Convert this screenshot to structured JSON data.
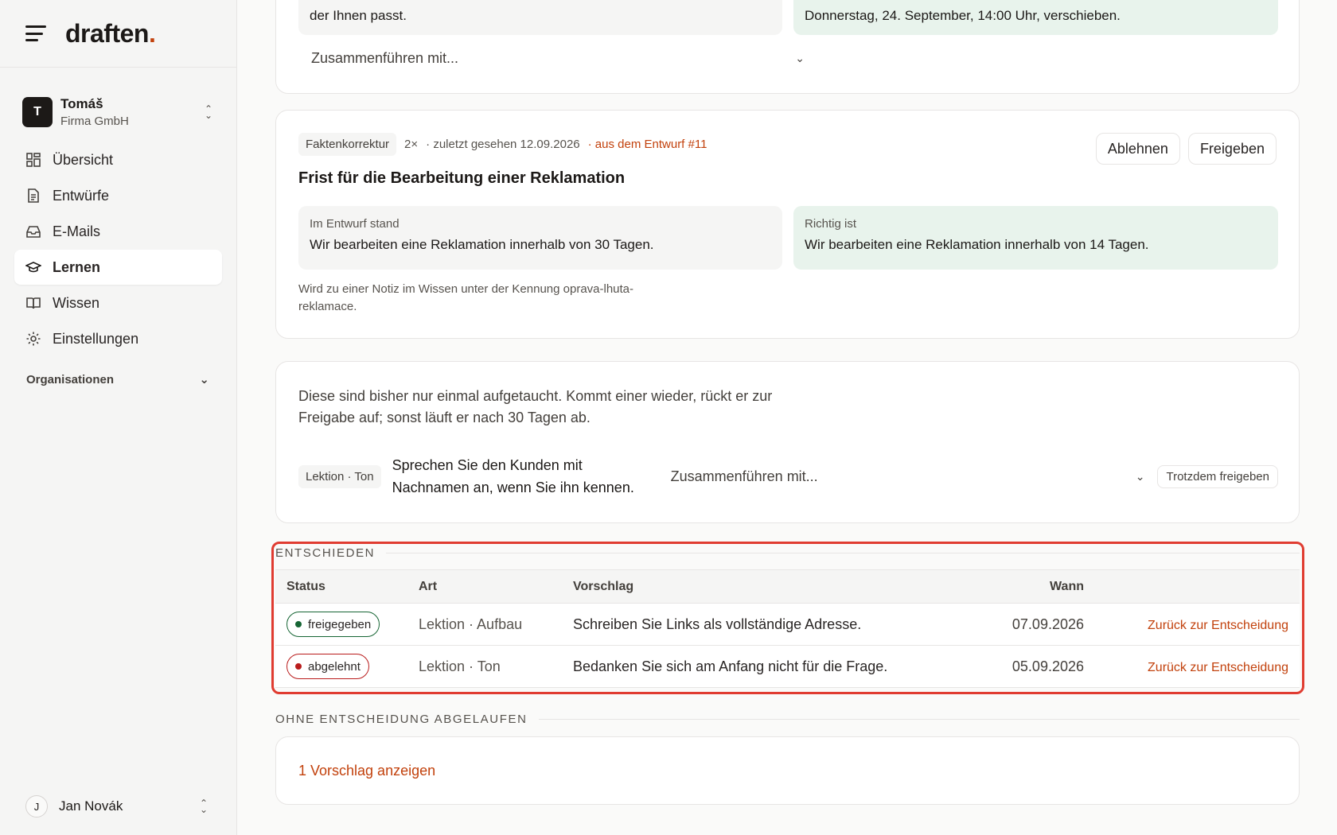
{
  "brand": {
    "logo_text": "draften",
    "logo_dot": "."
  },
  "account": {
    "initial": "T",
    "name": "Tomáš",
    "org": "Firma GmbH"
  },
  "nav": [
    {
      "label": "Übersicht",
      "icon": "dashboard-icon",
      "active": false
    },
    {
      "label": "Entwürfe",
      "icon": "document-icon",
      "active": false
    },
    {
      "label": "E-Mails",
      "icon": "inbox-icon",
      "active": false
    },
    {
      "label": "Lernen",
      "icon": "graduation-cap-icon",
      "active": true
    },
    {
      "label": "Wissen",
      "icon": "book-icon",
      "active": false
    },
    {
      "label": "Einstellungen",
      "icon": "gear-icon",
      "active": false
    }
  ],
  "organisations_label": "Organisationen",
  "user": {
    "initial": "J",
    "name": "Jan Novák"
  },
  "card1": {
    "old_text": "der Ihnen passt.",
    "new_text": "Donnerstag, 24. September, 14:00 Uhr, verschieben.",
    "merge_select": "Zusammenführen mit..."
  },
  "card2": {
    "tag": "Faktenkorrektur",
    "count": "2×",
    "last_seen": "· zuletzt gesehen 12.09.2026",
    "source": "· aus dem Entwurf #11",
    "title": "Frist für die Bearbeitung einer Reklamation",
    "reject_label": "Ablehnen",
    "approve_label": "Freigeben",
    "old_caption": "Im Entwurf stand",
    "old_text": "Wir bearbeiten eine Reklamation innerhalb von 30 Tagen.",
    "new_caption": "Richtig ist",
    "new_text": "Wir bearbeiten eine Reklamation innerhalb von 14 Tagen.",
    "note": "Wird zu einer Notiz im Wissen unter der Kennung oprava-lhuta-reklamace."
  },
  "card3": {
    "intro": "Diese sind bisher nur einmal aufgetaucht. Kommt einer wieder, rückt er zur Freigabe auf; sonst läuft er nach 30 Tagen ab.",
    "tag": "Lektion · Ton",
    "suggestion": "Sprechen Sie den Kunden mit Nachnamen an, wenn Sie ihn kennen.",
    "merge_select": "Zusammenführen mit...",
    "force_label": "Trotzdem freigeben"
  },
  "decided": {
    "label": "ENTSCHIEDEN",
    "columns": {
      "status": "Status",
      "art": "Art",
      "vorschlag": "Vorschlag",
      "wann": "Wann"
    },
    "rows": [
      {
        "status": "freigegeben",
        "status_kind": "ok",
        "art": "Lektion · Aufbau",
        "vorschlag": "Schreiben Sie Links als vollständige Adresse.",
        "wann": "07.09.2026",
        "action": "Zurück zur Entscheidung"
      },
      {
        "status": "abgelehnt",
        "status_kind": "no",
        "art": "Lektion · Ton",
        "vorschlag": "Bedanken Sie sich am Anfang nicht für die Frage.",
        "wann": "05.09.2026",
        "action": "Zurück zur Entscheidung"
      }
    ]
  },
  "expired": {
    "label": "OHNE ENTSCHEIDUNG ABGELAUFEN",
    "link": "1 Vorschlag anzeigen"
  }
}
